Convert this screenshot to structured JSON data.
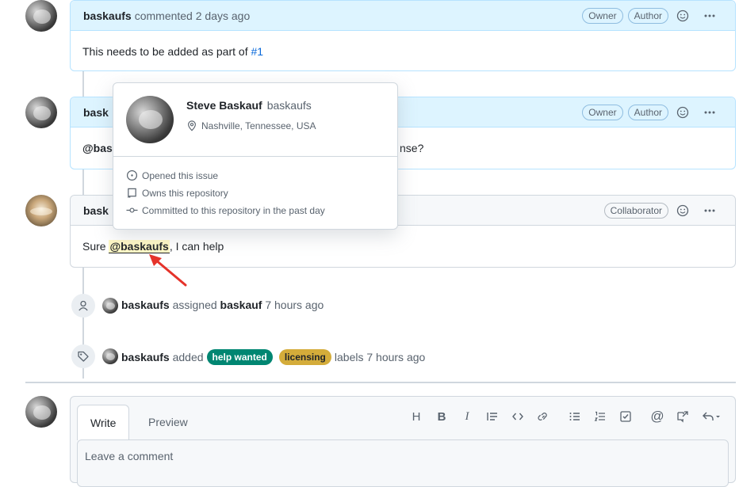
{
  "comments": [
    {
      "author": "baskaufs",
      "meta": "commented 2 days ago",
      "badges": [
        "Owner",
        "Author"
      ],
      "body_prefix": "This needs to be added as part of ",
      "body_ref": "#1"
    },
    {
      "author_visible": "bask",
      "badges": [
        "Owner",
        "Author"
      ],
      "body_left": "@bas",
      "body_right": "nse?"
    },
    {
      "author_visible": "bask",
      "badges": [
        "Collaborator"
      ],
      "body_prefix": "Sure ",
      "mention": "@baskaufs",
      "body_suffix": ", I can help"
    }
  ],
  "events": {
    "assigned": {
      "actor": "baskaufs",
      "verb": "assigned",
      "target": "baskauf",
      "time": "7 hours ago"
    },
    "labeled": {
      "actor": "baskaufs",
      "verb": "added",
      "suffix": "labels 7 hours ago",
      "labels": [
        {
          "name": "help wanted",
          "color": "#008672"
        },
        {
          "name": "licensing",
          "color": "#d4ac3a"
        }
      ]
    }
  },
  "hovercard": {
    "name": "Steve Baskauf",
    "login": "baskaufs",
    "location": "Nashville, Tennessee, USA",
    "facts": [
      "Opened this issue",
      "Owns this repository",
      "Committed to this repository in the past day"
    ]
  },
  "editor": {
    "tabs": [
      "Write",
      "Preview"
    ],
    "placeholder": "Leave a comment",
    "toolbar_icons": [
      "heading-icon",
      "bold-icon",
      "italic-icon",
      "quote-icon",
      "code-icon",
      "link-icon",
      "unordered-list-icon",
      "ordered-list-icon",
      "task-list-icon",
      "mention-icon",
      "cross-reference-icon",
      "saved-replies-icon"
    ]
  },
  "colors": {
    "link": "#0969da",
    "owner_header": "#ddf4ff",
    "mention_bg": "#fff8c5",
    "arrow": "#e5332a"
  }
}
